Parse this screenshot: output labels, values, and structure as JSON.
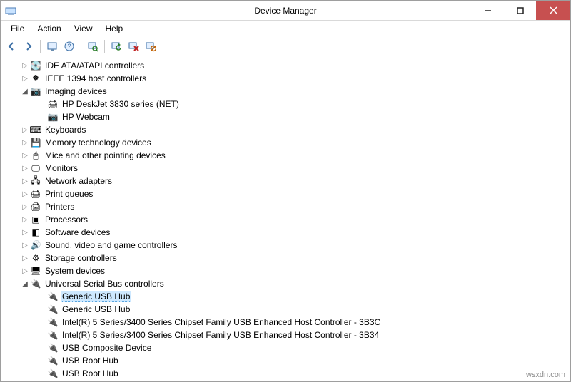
{
  "window": {
    "title": "Device Manager"
  },
  "menubar": {
    "items": [
      {
        "label": "File"
      },
      {
        "label": "Action"
      },
      {
        "label": "View"
      },
      {
        "label": "Help"
      }
    ]
  },
  "toolbar": {
    "back_icon": "←",
    "forward_icon": "→",
    "show_hidden_icon": "🖥",
    "help_icon": "?",
    "scan_icon": "🔍",
    "update_icon": "⟳",
    "uninstall_icon": "✖",
    "disable_icon": "⊘"
  },
  "tree": {
    "nodes": [
      {
        "ind": 1,
        "state": "collapsed",
        "icon": "💽",
        "label": "IDE ATA/ATAPI controllers",
        "interactable": true
      },
      {
        "ind": 1,
        "state": "collapsed",
        "icon": "🞿",
        "label": "IEEE 1394 host controllers",
        "interactable": true
      },
      {
        "ind": 1,
        "state": "expanded",
        "icon": "📷",
        "label": "Imaging devices",
        "interactable": true
      },
      {
        "ind": 2,
        "state": "leaf",
        "icon": "🖨",
        "label": "HP DeskJet 3830 series (NET)",
        "interactable": true
      },
      {
        "ind": 2,
        "state": "leaf",
        "icon": "📷",
        "label": "HP Webcam",
        "interactable": true
      },
      {
        "ind": 1,
        "state": "collapsed",
        "icon": "⌨",
        "label": "Keyboards",
        "interactable": true
      },
      {
        "ind": 1,
        "state": "collapsed",
        "icon": "💾",
        "label": "Memory technology devices",
        "interactable": true
      },
      {
        "ind": 1,
        "state": "collapsed",
        "icon": "🖱",
        "label": "Mice and other pointing devices",
        "interactable": true
      },
      {
        "ind": 1,
        "state": "collapsed",
        "icon": "🖵",
        "label": "Monitors",
        "interactable": true
      },
      {
        "ind": 1,
        "state": "collapsed",
        "icon": "🖧",
        "label": "Network adapters",
        "interactable": true
      },
      {
        "ind": 1,
        "state": "collapsed",
        "icon": "🖨",
        "label": "Print queues",
        "interactable": true
      },
      {
        "ind": 1,
        "state": "collapsed",
        "icon": "🖨",
        "label": "Printers",
        "interactable": true
      },
      {
        "ind": 1,
        "state": "collapsed",
        "icon": "▣",
        "label": "Processors",
        "interactable": true
      },
      {
        "ind": 1,
        "state": "collapsed",
        "icon": "◧",
        "label": "Software devices",
        "interactable": true
      },
      {
        "ind": 1,
        "state": "collapsed",
        "icon": "🔊",
        "label": "Sound, video and game controllers",
        "interactable": true
      },
      {
        "ind": 1,
        "state": "collapsed",
        "icon": "⚙",
        "label": "Storage controllers",
        "interactable": true
      },
      {
        "ind": 1,
        "state": "collapsed",
        "icon": "🖥",
        "label": "System devices",
        "interactable": true
      },
      {
        "ind": 1,
        "state": "expanded",
        "icon": "🔌",
        "label": "Universal Serial Bus controllers",
        "interactable": true
      },
      {
        "ind": 2,
        "state": "leaf",
        "icon": "🔌",
        "label": "Generic USB Hub",
        "selected": true,
        "interactable": true
      },
      {
        "ind": 2,
        "state": "leaf",
        "icon": "🔌",
        "label": "Generic USB Hub",
        "interactable": true
      },
      {
        "ind": 2,
        "state": "leaf",
        "icon": "🔌",
        "label": "Intel(R) 5 Series/3400 Series Chipset Family USB Enhanced Host Controller - 3B3C",
        "interactable": true
      },
      {
        "ind": 2,
        "state": "leaf",
        "icon": "🔌",
        "label": "Intel(R) 5 Series/3400 Series Chipset Family USB Enhanced Host Controller - 3B34",
        "interactable": true
      },
      {
        "ind": 2,
        "state": "leaf",
        "icon": "🔌",
        "label": "USB Composite Device",
        "interactable": true
      },
      {
        "ind": 2,
        "state": "leaf",
        "icon": "🔌",
        "label": "USB Root Hub",
        "interactable": true
      },
      {
        "ind": 2,
        "state": "leaf",
        "icon": "🔌",
        "label": "USB Root Hub",
        "interactable": true
      }
    ]
  },
  "watermark": "wsxdn.com"
}
